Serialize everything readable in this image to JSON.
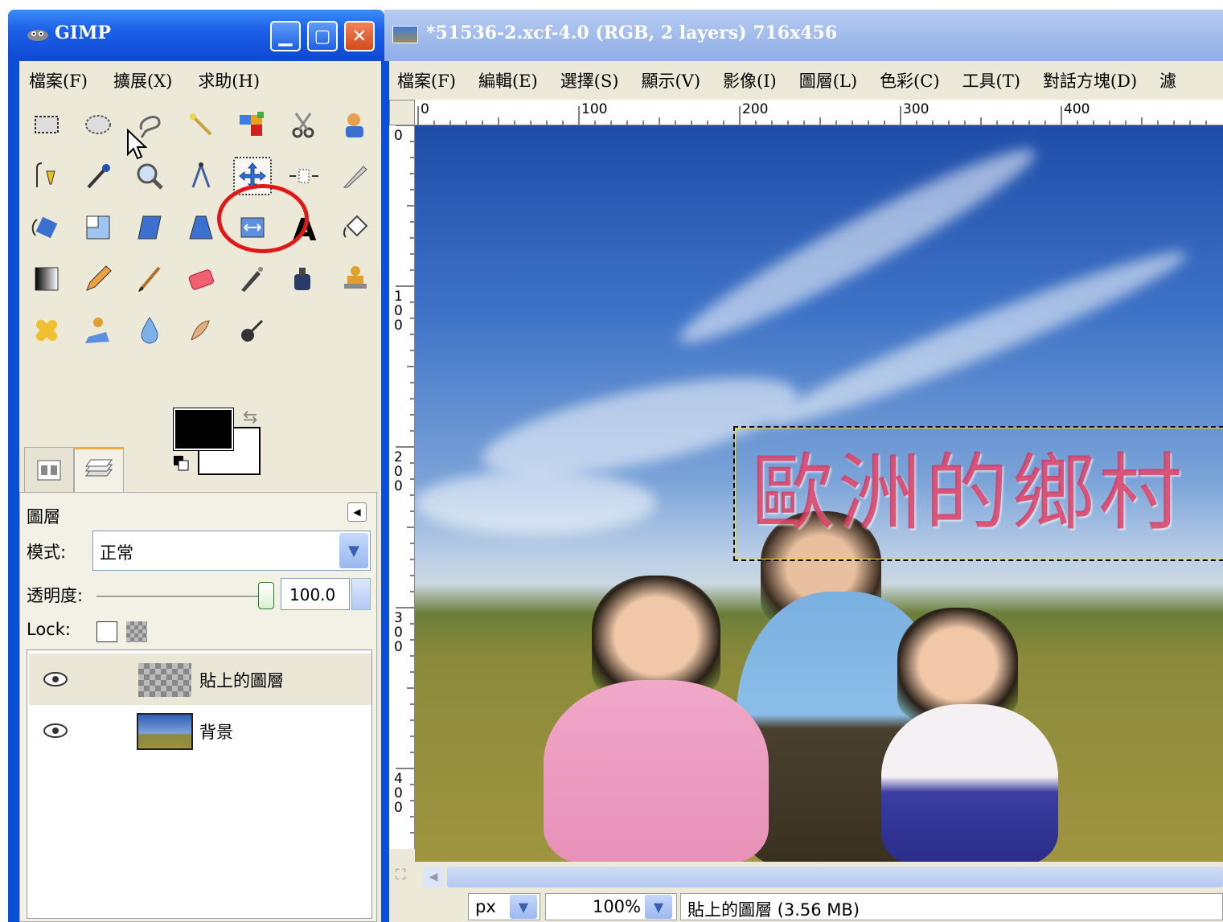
{
  "toolbox": {
    "title": "GIMP",
    "menu": [
      "檔案(F)",
      "擴展(X)",
      "求助(H)"
    ],
    "tools": [
      "rect-select",
      "ellipse-select",
      "free-select",
      "fuzzy-select",
      "select-by-color",
      "scissors",
      "foreground-select",
      "paths",
      "color-picker",
      "zoom",
      "measure",
      "move",
      "align",
      "crop",
      "rotate",
      "scale",
      "shear",
      "perspective",
      "flip",
      "text",
      "bucket-fill",
      "blend",
      "pencil",
      "paintbrush",
      "eraser",
      "airbrush",
      "ink",
      "clone",
      "heal",
      "perspective-clone",
      "blur",
      "smudge",
      "dodge-burn"
    ],
    "active_tool": "move",
    "fg_color": "#000000",
    "bg_color": "#ffffff"
  },
  "layers_panel": {
    "title": "圖層",
    "mode_label": "模式:",
    "mode_value": "正常",
    "opacity_label": "透明度:",
    "opacity_value": "100.0",
    "lock_label": "Lock:",
    "layers": [
      {
        "name": "貼上的圖層",
        "visible": true,
        "selected": true
      },
      {
        "name": "背景",
        "visible": true,
        "selected": false
      }
    ]
  },
  "image_window": {
    "title": "*51536-2.xcf-4.0 (RGB, 2 layers) 716x456",
    "menu": [
      "檔案(F)",
      "編輯(E)",
      "選擇(S)",
      "顯示(V)",
      "影像(I)",
      "圖層(L)",
      "色彩(C)",
      "工具(T)",
      "對話方塊(D)",
      "濾"
    ],
    "hruler_labels": [
      "0",
      "100",
      "200",
      "300",
      "400"
    ],
    "vruler_labels": [
      "0",
      "100",
      "200",
      "300",
      "400"
    ],
    "canvas_text": "歐洲的鄉村",
    "status": {
      "unit": "px",
      "zoom": "100%",
      "info": "貼上的圖層 (3.56 MB)"
    }
  },
  "colors": {
    "xp_title_blue": "#0a4fd6",
    "dialog_bg": "#ece9d8",
    "highlight_circle": "#e01818"
  }
}
